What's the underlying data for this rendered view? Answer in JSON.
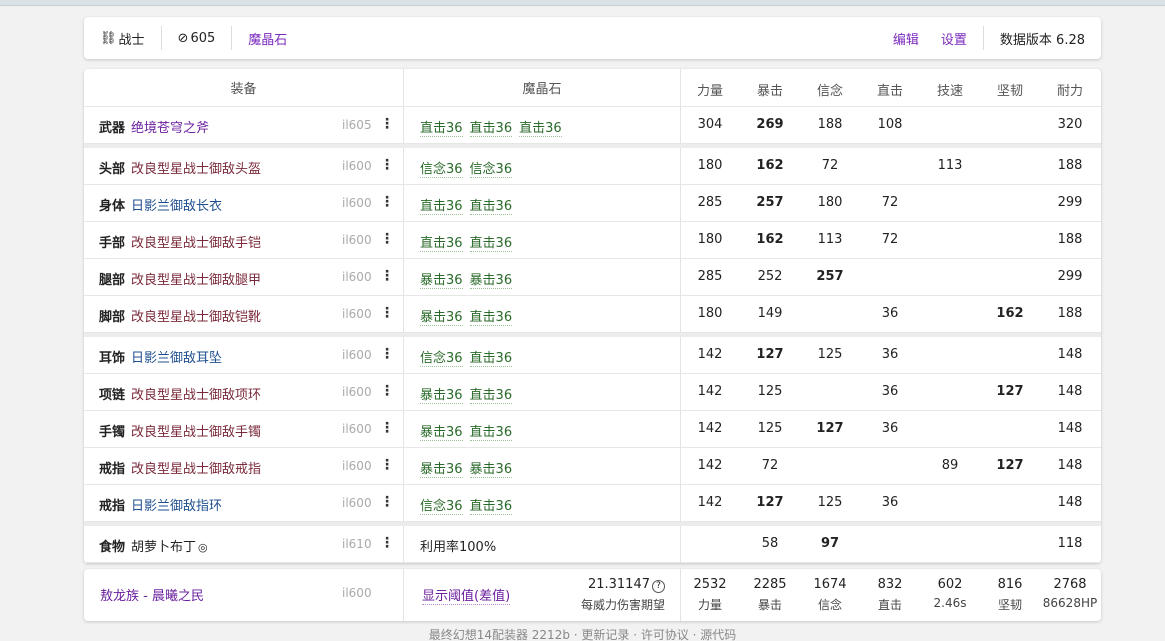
{
  "header": {
    "job": "战士",
    "job_icon": "link-icon",
    "item_level": "605",
    "item_level_icon": "circle-slash-icon",
    "materia_tab": "魔晶石",
    "edit": "编辑",
    "settings": "设置",
    "data_version": "数据版本 6.28"
  },
  "columns": {
    "gear": "装备",
    "materia": "魔晶石",
    "stats": [
      "力量",
      "暴击",
      "信念",
      "直击",
      "技速",
      "坚韧",
      "耐力"
    ]
  },
  "rows": [
    {
      "slot": "武器",
      "name": "绝境苍穹之斧",
      "color": "#6a1f9e",
      "il": "il605",
      "materia": [
        "直击36",
        "直击36",
        "直击36"
      ],
      "stats": [
        "304",
        "269",
        "188",
        "108",
        "",
        "",
        "320"
      ],
      "bold": [
        1
      ]
    },
    {
      "slot": "头部",
      "name": "改良型星战士御敌头盔",
      "color": "#7a2a3a",
      "il": "il600",
      "materia": [
        "信念36",
        "信念36"
      ],
      "stats": [
        "180",
        "162",
        "72",
        "",
        "113",
        "",
        "188"
      ],
      "bold": [
        1
      ]
    },
    {
      "slot": "身体",
      "name": "日影兰御敌长衣",
      "color": "#1f4f8f",
      "il": "il600",
      "materia": [
        "直击36",
        "直击36"
      ],
      "stats": [
        "285",
        "257",
        "180",
        "72",
        "",
        "",
        "299"
      ],
      "bold": [
        1
      ]
    },
    {
      "slot": "手部",
      "name": "改良型星战士御敌手铠",
      "color": "#7a2a3a",
      "il": "il600",
      "materia": [
        "直击36",
        "直击36"
      ],
      "stats": [
        "180",
        "162",
        "113",
        "72",
        "",
        "",
        "188"
      ],
      "bold": [
        1
      ]
    },
    {
      "slot": "腿部",
      "name": "改良型星战士御敌腿甲",
      "color": "#7a2a3a",
      "il": "il600",
      "materia": [
        "暴击36",
        "暴击36"
      ],
      "stats": [
        "285",
        "252",
        "257",
        "",
        "",
        "",
        "299"
      ],
      "bold": [
        2
      ]
    },
    {
      "slot": "脚部",
      "name": "改良型星战士御敌铠靴",
      "color": "#7a2a3a",
      "il": "il600",
      "materia": [
        "暴击36",
        "直击36"
      ],
      "stats": [
        "180",
        "149",
        "",
        "36",
        "",
        "162",
        "188"
      ],
      "bold": [
        5
      ]
    },
    {
      "slot": "耳饰",
      "name": "日影兰御敌耳坠",
      "color": "#1f4f8f",
      "il": "il600",
      "materia": [
        "信念36",
        "直击36"
      ],
      "stats": [
        "142",
        "127",
        "125",
        "36",
        "",
        "",
        "148"
      ],
      "bold": [
        1
      ]
    },
    {
      "slot": "项链",
      "name": "改良型星战士御敌项环",
      "color": "#7a2a3a",
      "il": "il600",
      "materia": [
        "暴击36",
        "直击36"
      ],
      "stats": [
        "142",
        "125",
        "",
        "36",
        "",
        "127",
        "148"
      ],
      "bold": [
        5
      ]
    },
    {
      "slot": "手镯",
      "name": "改良型星战士御敌手镯",
      "color": "#7a2a3a",
      "il": "il600",
      "materia": [
        "暴击36",
        "直击36"
      ],
      "stats": [
        "142",
        "125",
        "127",
        "36",
        "",
        "",
        "148"
      ],
      "bold": [
        2
      ]
    },
    {
      "slot": "戒指",
      "name": "改良型星战士御敌戒指",
      "color": "#7a2a3a",
      "il": "il600",
      "materia": [
        "暴击36",
        "暴击36"
      ],
      "stats": [
        "142",
        "72",
        "",
        "",
        "89",
        "127",
        "148"
      ],
      "bold": [
        5
      ]
    },
    {
      "slot": "戒指",
      "name": "日影兰御敌指环",
      "color": "#1f4f8f",
      "il": "il600",
      "materia": [
        "信念36",
        "直击36"
      ],
      "stats": [
        "142",
        "127",
        "125",
        "36",
        "",
        "",
        "148"
      ],
      "bold": [
        1
      ]
    },
    {
      "slot": "食物",
      "name": "胡萝卜布丁",
      "name_suffix_icon": "hq-icon",
      "color": "#222222",
      "il": "il610",
      "materia": [
        "利用率100%"
      ],
      "plain_materia": true,
      "stats": [
        "",
        "58",
        "97",
        "",
        "",
        "",
        "118"
      ],
      "bold": [
        2
      ]
    }
  ],
  "summary": {
    "clan": "敖龙族 - 晨曦之民",
    "il": "il600",
    "threshold": "显示阈值(差值)",
    "damage_value": "21.31147",
    "damage_label": "每威力伤害期望",
    "totals": [
      "2532",
      "2285",
      "1674",
      "832",
      "602",
      "816",
      "2768"
    ],
    "sub_labels": [
      "力量",
      "暴击",
      "信念",
      "直击",
      "2.46s",
      "坚韧",
      "86628HP"
    ]
  },
  "footer": "最终幻想14配装器 2212b · 更新记录 · 许可协议 · 源代码"
}
